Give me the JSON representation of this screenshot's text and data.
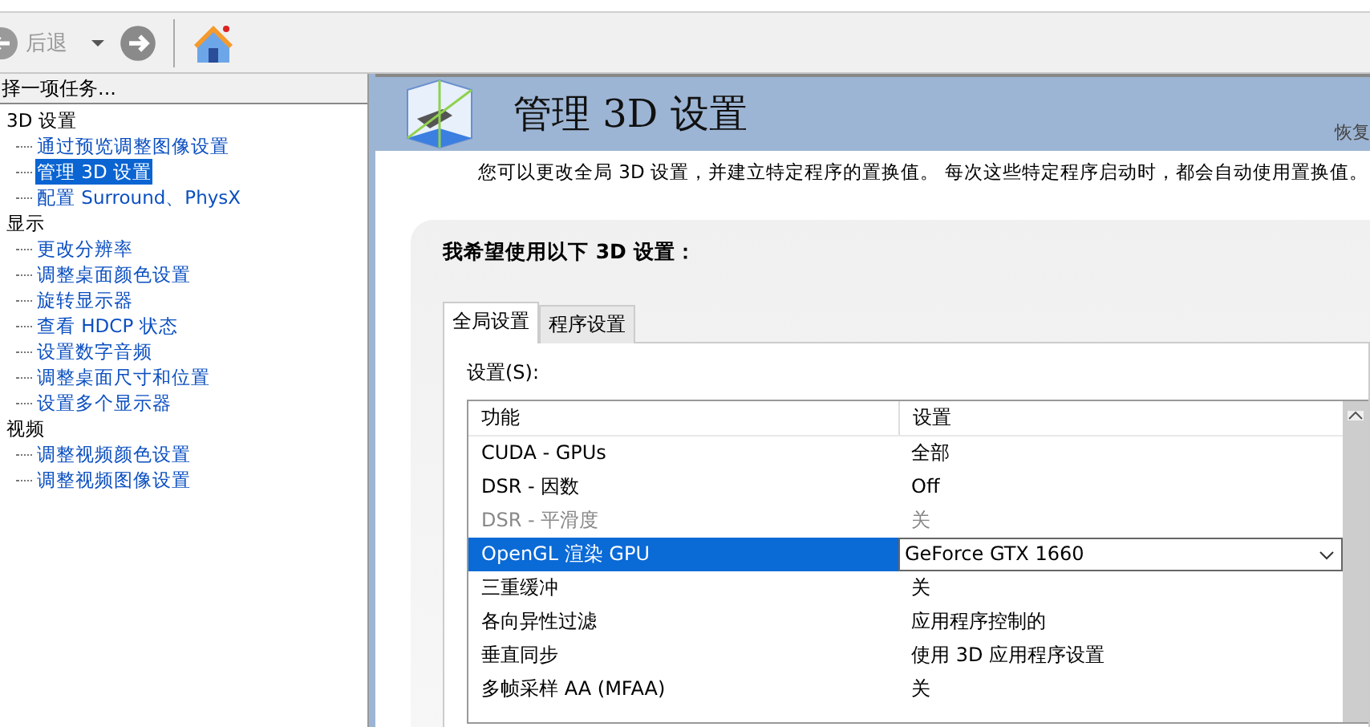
{
  "toolbar": {
    "back": {
      "label": "后退",
      "disabled": true
    }
  },
  "task_pane": {
    "title": "择一项任务...",
    "tree": [
      {
        "label": "3D 设置",
        "selected": false,
        "children": [
          {
            "label": "通过预览调整图像设置",
            "selected": false
          },
          {
            "label": "管理 3D 设置",
            "selected": true
          },
          {
            "label": "配置 Surround、PhysX",
            "selected": false
          }
        ]
      },
      {
        "label": "显示",
        "selected": false,
        "children": [
          {
            "label": "更改分辨率",
            "selected": false
          },
          {
            "label": "调整桌面颜色设置",
            "selected": false
          },
          {
            "label": "旋转显示器",
            "selected": false
          },
          {
            "label": "查看 HDCP 状态",
            "selected": false
          },
          {
            "label": "设置数字音频",
            "selected": false
          },
          {
            "label": "调整桌面尺寸和位置",
            "selected": false
          },
          {
            "label": "设置多个显示器",
            "selected": false
          }
        ]
      },
      {
        "label": "视频",
        "selected": false,
        "children": [
          {
            "label": "调整视频颜色设置",
            "selected": false
          },
          {
            "label": "调整视频图像设置",
            "selected": false
          }
        ]
      }
    ]
  },
  "page": {
    "title": "管理 3D 设置",
    "restore_link": "恢复",
    "description": "您可以更改全局 3D 设置，并建立特定程序的置换值。 每次这些特定程序启动时，都会自动使用置换值。",
    "heading": "我希望使用以下 3D 设置：",
    "tabs": [
      {
        "label": "全局设置",
        "selected": true
      },
      {
        "label": "程序设置",
        "selected": false
      }
    ],
    "settings_label": "设置(S):",
    "table": {
      "columns": [
        "功能",
        "设置"
      ],
      "rows": [
        {
          "feature": "CUDA - GPUs",
          "value": "全部",
          "kind": "text",
          "disabled": false,
          "selected": false
        },
        {
          "feature": "DSR - 因数",
          "value": "Off",
          "kind": "text",
          "disabled": false,
          "selected": false
        },
        {
          "feature": "DSR - 平滑度",
          "value": "关",
          "kind": "text",
          "disabled": true,
          "selected": false
        },
        {
          "feature": "OpenGL 渲染 GPU",
          "value": "GeForce GTX 1660",
          "kind": "dropdown",
          "disabled": false,
          "selected": true
        },
        {
          "feature": "三重缓冲",
          "value": "关",
          "kind": "text",
          "disabled": false,
          "selected": false
        },
        {
          "feature": "各向异性过滤",
          "value": "应用程序控制的",
          "kind": "text",
          "disabled": false,
          "selected": false
        },
        {
          "feature": "垂直同步",
          "value": "使用 3D 应用程序设置",
          "kind": "text",
          "disabled": false,
          "selected": false
        },
        {
          "feature": "多帧采样 AA (MFAA)",
          "value": "关",
          "kind": "text",
          "disabled": false,
          "selected": false
        }
      ]
    }
  }
}
